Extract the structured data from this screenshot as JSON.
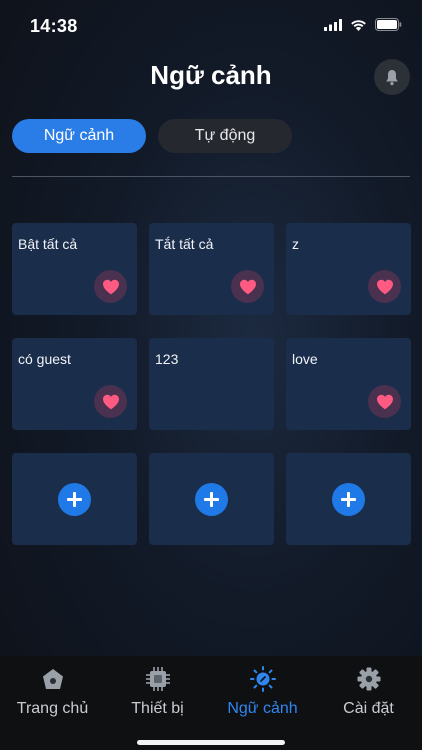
{
  "status_bar": {
    "time": "14:38"
  },
  "header": {
    "title": "Ngữ cảnh"
  },
  "tabs": [
    {
      "label": "Ngữ cảnh",
      "active": true
    },
    {
      "label": "Tự động",
      "active": false
    }
  ],
  "scenes": [
    {
      "label": "Bật tất cả",
      "favorite": true
    },
    {
      "label": "Tắt tất cả",
      "favorite": true
    },
    {
      "label": "z",
      "favorite": true
    },
    {
      "label": "có guest",
      "favorite": true
    },
    {
      "label": "123",
      "favorite": false
    },
    {
      "label": "love",
      "favorite": true
    }
  ],
  "add_slots": 3,
  "bottom_nav": [
    {
      "label": "Trang chủ",
      "icon": "home-icon",
      "active": false
    },
    {
      "label": "Thiết bị",
      "icon": "chip-icon",
      "active": false
    },
    {
      "label": "Ngữ cảnh",
      "icon": "scene-icon",
      "active": true
    },
    {
      "label": "Cài đặt",
      "icon": "gear-icon",
      "active": false
    }
  ],
  "colors": {
    "accent": "#2a7de6",
    "heart": "#ff5a82",
    "card": "#1a2d4b"
  }
}
